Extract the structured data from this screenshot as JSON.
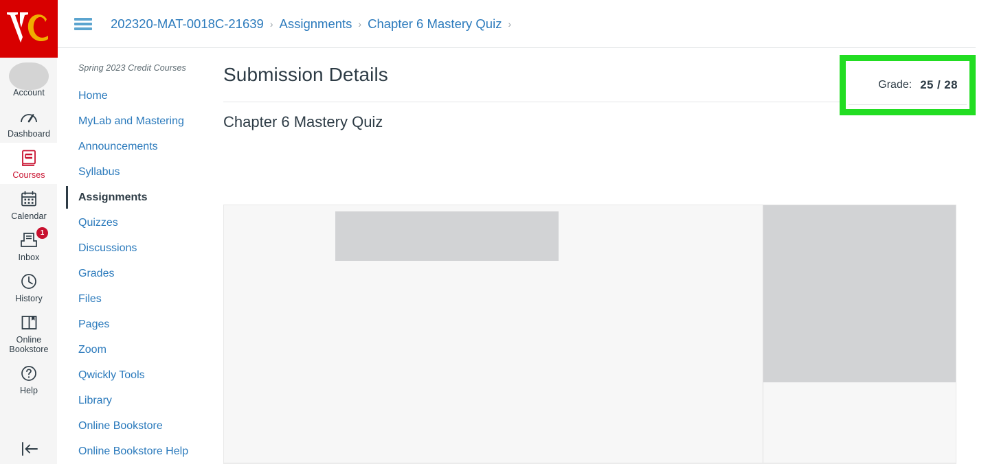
{
  "global_nav": {
    "logo": {
      "text": "VC",
      "bg_color": "#d80000",
      "letter_v_color": "#ffffff",
      "letter_c_color": "#f0ad00"
    },
    "items": [
      {
        "label": "Account",
        "icon": "avatar-icon",
        "active": false,
        "badge": null
      },
      {
        "label": "Dashboard",
        "icon": "dashboard-gauge-icon",
        "active": false,
        "badge": null
      },
      {
        "label": "Courses",
        "icon": "courses-book-icon",
        "active": true,
        "badge": null
      },
      {
        "label": "Calendar",
        "icon": "calendar-icon",
        "active": false,
        "badge": null
      },
      {
        "label": "Inbox",
        "icon": "inbox-tray-icon",
        "active": false,
        "badge": "1"
      },
      {
        "label": "History",
        "icon": "clock-icon",
        "active": false,
        "badge": null
      },
      {
        "label": "Online Bookstore",
        "icon": "open-book-icon",
        "active": false,
        "badge": null
      },
      {
        "label": "Help",
        "icon": "question-circle-icon",
        "active": false,
        "badge": null
      }
    ],
    "collapse": {
      "icon": "collapse-left-arrow-icon"
    },
    "active_color": "#c8102e",
    "badge_color": "#c8102e"
  },
  "topbar": {
    "menu_icon": "hamburger-menu-icon",
    "breadcrumb": [
      {
        "label": "202320-MAT-0018C-21639"
      },
      {
        "label": "Assignments"
      },
      {
        "label": "Chapter 6 Mastery Quiz"
      }
    ],
    "separator": "›",
    "link_color": "#2b7abc"
  },
  "course_nav": {
    "term": "Spring 2023 Credit Courses",
    "items": [
      {
        "label": "Home",
        "active": false
      },
      {
        "label": "MyLab and Mastering",
        "active": false
      },
      {
        "label": "Announcements",
        "active": false
      },
      {
        "label": "Syllabus",
        "active": false
      },
      {
        "label": "Assignments",
        "active": true
      },
      {
        "label": "Quizzes",
        "active": false
      },
      {
        "label": "Discussions",
        "active": false
      },
      {
        "label": "Grades",
        "active": false
      },
      {
        "label": "Files",
        "active": false
      },
      {
        "label": "Pages",
        "active": false
      },
      {
        "label": "Zoom",
        "active": false
      },
      {
        "label": "Qwickly Tools",
        "active": false
      },
      {
        "label": "Library",
        "active": false
      },
      {
        "label": "Online Bookstore",
        "active": false
      },
      {
        "label": "Online Bookstore Help",
        "active": false
      }
    ]
  },
  "main": {
    "page_title": "Submission Details",
    "assignment_name": "Chapter 6 Mastery Quiz",
    "grade": {
      "label": "Grade:",
      "value": "25 / 28",
      "score": 25,
      "possible": 28,
      "highlight_color": "#22dd22"
    },
    "preview": {
      "state": "loading-placeholder",
      "background_color": "#f7f7f7",
      "placeholder_color": "#d2d3d5"
    }
  }
}
